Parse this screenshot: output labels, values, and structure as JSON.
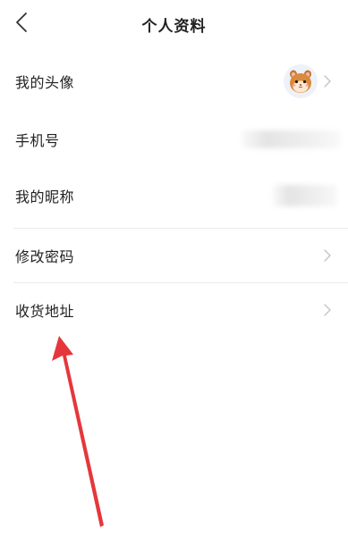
{
  "header": {
    "title": "个人资料"
  },
  "rows": [
    {
      "label": "我的头像"
    },
    {
      "label": "手机号"
    },
    {
      "label": "我的昵称"
    },
    {
      "label": "修改密码"
    },
    {
      "label": "收货地址"
    }
  ],
  "icons": {
    "back": "back-chevron-icon",
    "row_arrow": "chevron-right-icon",
    "avatar": "hamster-avatar",
    "annotation": "red-arrow"
  },
  "colors": {
    "annotation_arrow": "#e5373b",
    "divider": "#ececec",
    "chevron": "#c4c4c4"
  }
}
